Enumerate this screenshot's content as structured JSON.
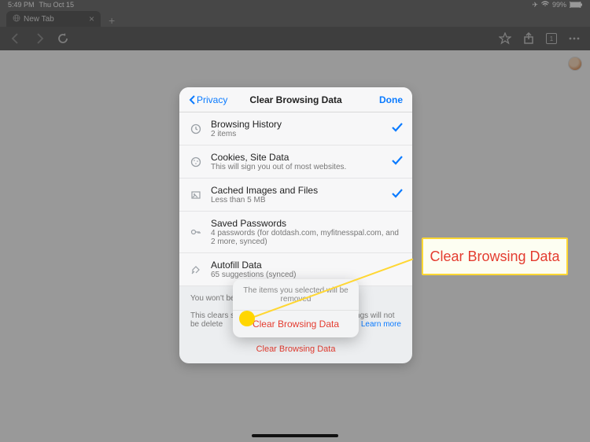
{
  "status": {
    "time": "5:49 PM",
    "date": "Thu Oct 15",
    "battery": "99%"
  },
  "tab": {
    "title": "New Tab",
    "count": "1"
  },
  "modal": {
    "back": "Privacy",
    "title": "Clear Browsing Data",
    "done": "Done",
    "items": [
      {
        "title": "Browsing History",
        "sub": "2 items",
        "checked": true
      },
      {
        "title": "Cookies, Site Data",
        "sub": "This will sign you out of most websites.",
        "checked": true
      },
      {
        "title": "Cached Images and Files",
        "sub": "Less than 5 MB",
        "checked": true
      },
      {
        "title": "Saved Passwords",
        "sub": "4 passwords (for dotdash.com, myfitnesspal.com, and 2 more, synced)",
        "checked": false
      },
      {
        "title": "Autofill Data",
        "sub": "65 suggestions (synced)",
        "checked": false
      }
    ],
    "foot_pre": "You won't be ",
    "foot_mid": "This clears sy",
    "foot_post1": "ettings will not be delete",
    "learn": "Learn more",
    "clear": "Clear Browsing Data"
  },
  "confirm": {
    "msg": "The items you selected will be removed",
    "btn": "Clear Browsing Data"
  },
  "callout": "Clear Browsing Data"
}
